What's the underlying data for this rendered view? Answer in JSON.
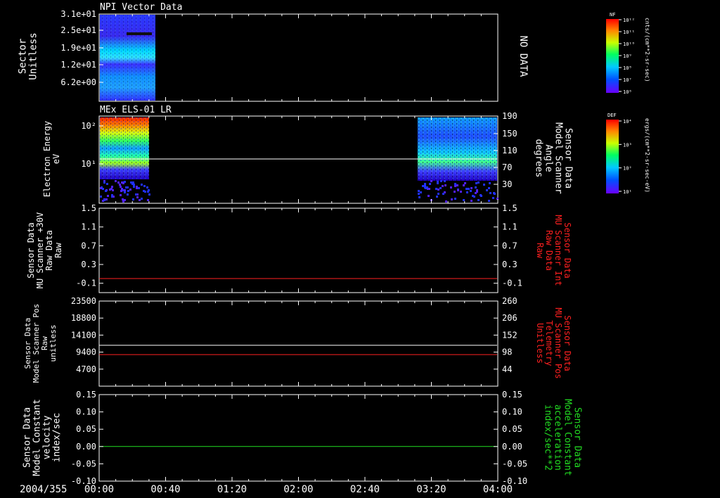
{
  "colors": {
    "background": "#000000",
    "axis": "#ffffff",
    "red": "#ff2020",
    "green": "#22dd22"
  },
  "chart_data": [
    {
      "type": "heatmap",
      "title": "NPI Vector Data",
      "ylabel_lines": [
        "Sector",
        "Unitless"
      ],
      "y_ticks": [
        "3.1e+01",
        "2.5e+01",
        "1.9e+01",
        "1.2e+01",
        "6.2e+00"
      ],
      "x_range": [
        "00:00",
        "04:00"
      ],
      "data_coverage": [
        [
          "00:00",
          "00:21"
        ]
      ],
      "right_note": "NO DATA",
      "colorbar": {
        "label": "NF",
        "unit": "cnts/(cm**2-sr-sec)",
        "ticks": [
          "10¹²",
          "10¹¹",
          "10¹⁰",
          "10⁹",
          "10⁸",
          "10⁷",
          "10⁶"
        ]
      }
    },
    {
      "type": "heatmap",
      "title": "MEx ELS-01 LR",
      "ylabel_lines": [
        "Electron Energy",
        "eV"
      ],
      "y_ticks": [
        "10²",
        "10¹"
      ],
      "y_scale": "log",
      "data_coverage": [
        [
          "00:00",
          "00:19"
        ],
        [
          "03:17",
          "04:00"
        ]
      ],
      "right_ylabel_lines": [
        "Sensor Data",
        "Model Scanner",
        "Angle",
        "degrees"
      ],
      "right_ticks": [
        "190",
        "150",
        "110",
        "70",
        "30"
      ],
      "overlay_line": {
        "color": "white",
        "value": 90
      },
      "colorbar": {
        "label": "DEF",
        "unit": "ergs/(cm**2-sr-sec-eV)",
        "ticks": [
          "10⁴",
          "10³",
          "10²",
          "10¹"
        ]
      }
    },
    {
      "type": "line",
      "left_ylabel_lines": [
        "Sensor Data",
        "MU Scanner +30V",
        "Raw Data",
        "Raw"
      ],
      "left_ticks": [
        "1.5",
        "1.1",
        "0.7",
        "0.3",
        "-0.1"
      ],
      "ylim": [
        -0.3,
        1.5
      ],
      "right_ylabel_lines": [
        "Sensor Data",
        "MU Scanner Int",
        "Raw Data",
        "Raw"
      ],
      "right_ticks": [
        "1.5",
        "1.1",
        "0.7",
        "0.3",
        "-0.1"
      ],
      "series": [
        {
          "color": "red",
          "x": [
            "00:00",
            "04:00"
          ],
          "y": [
            0.0,
            0.0
          ]
        }
      ]
    },
    {
      "type": "line",
      "left_ylabel_lines": [
        "Sensor Data",
        "Model Scanner Pos",
        "Raw",
        "unitless"
      ],
      "left_ticks": [
        "23500",
        "18800",
        "14100",
        "9400",
        "4700"
      ],
      "ylim": [
        0,
        23500
      ],
      "right_ylabel_lines": [
        "Sensor Data",
        "MU Scanner Pos",
        "Telemetry",
        "Unitless"
      ],
      "right_ticks": [
        "260",
        "206",
        "152",
        "98",
        "44"
      ],
      "right_ylim": [
        -10,
        260
      ],
      "series": [
        {
          "color": "white",
          "axis": "left",
          "x": [
            "00:00",
            "04:00"
          ],
          "y": [
            11300,
            11300
          ]
        },
        {
          "color": "red",
          "axis": "right",
          "x": [
            "00:00",
            "04:00"
          ],
          "y": [
            90,
            90
          ]
        }
      ]
    },
    {
      "type": "line",
      "left_ylabel_lines": [
        "Sensor Data",
        "Model Constant",
        "velocity",
        "index/sec"
      ],
      "left_ticks": [
        "0.15",
        "0.10",
        "0.05",
        "0.00",
        "-0.05",
        "-0.10"
      ],
      "ylim": [
        -0.1,
        0.15
      ],
      "right_ylabel_lines": [
        "Sensor Data",
        "Model Constant",
        "acceleration",
        "index/sec**2"
      ],
      "right_ticks": [
        "0.15",
        "0.10",
        "0.05",
        "0.00",
        "-0.05",
        "-0.10"
      ],
      "series": [
        {
          "color": "green",
          "x": [
            "00:00",
            "04:00"
          ],
          "y": [
            0.0,
            0.0
          ]
        }
      ]
    }
  ],
  "x_axis": {
    "date": "2004/355",
    "tick_labels": [
      "00:00",
      "00:40",
      "01:20",
      "02:00",
      "02:40",
      "03:20",
      "04:00"
    ]
  }
}
